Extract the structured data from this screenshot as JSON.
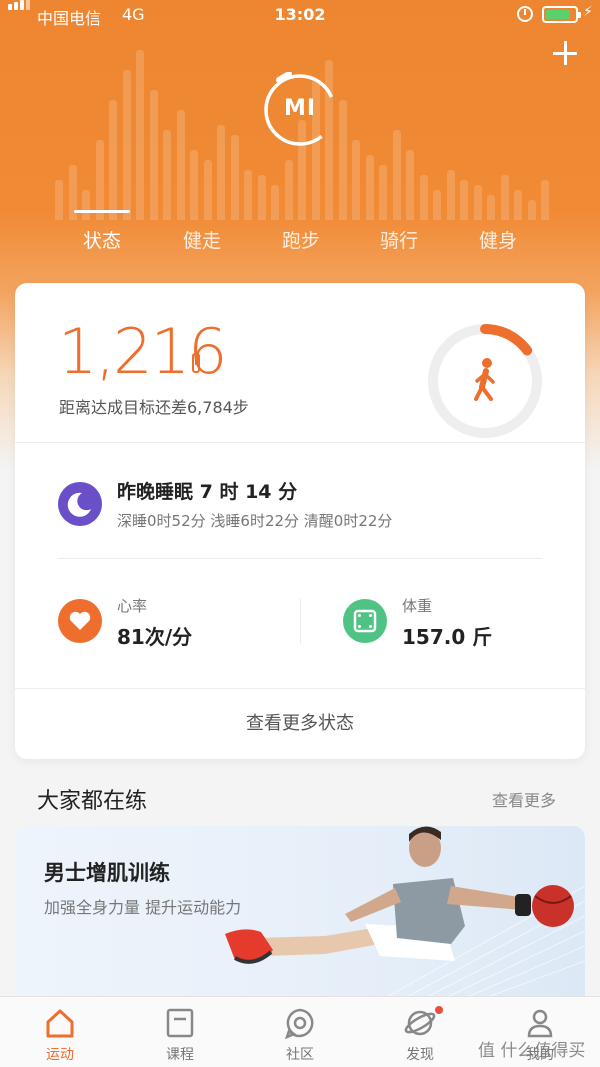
{
  "status_bar": {
    "carrier": "中国电信",
    "network": "4G",
    "time": "13:02",
    "battery_level": 0.85,
    "battery_color": "#5cd06e"
  },
  "header": {
    "logo_text": "MI",
    "add_icon": "plus-icon"
  },
  "tabs": [
    {
      "label": "状态",
      "active": true
    },
    {
      "label": "健走",
      "active": false
    },
    {
      "label": "跑步",
      "active": false
    },
    {
      "label": "骑行",
      "active": false
    },
    {
      "label": "健身",
      "active": false
    }
  ],
  "summary": {
    "steps": "1,216",
    "goal_text": "距离达成目标还差6,784步",
    "goal_progress": 0.15,
    "accent": "#ee6e2d"
  },
  "sleep": {
    "title": "昨晚睡眠 7 时 14 分",
    "detail": "深睡0时52分 浅睡6时22分 清醒0时22分"
  },
  "heart_rate": {
    "label": "心率",
    "value": "81次/分"
  },
  "weight": {
    "label": "体重",
    "value": "157.0 斤"
  },
  "more_status_label": "查看更多状态",
  "section": {
    "title": "大家都在练",
    "more": "查看更多"
  },
  "promo": {
    "title": "男士增肌训练",
    "subtitle": "加强全身力量 提升运动能力"
  },
  "nav": [
    {
      "label": "运动",
      "icon": "home-icon",
      "active": true
    },
    {
      "label": "课程",
      "icon": "course-icon",
      "active": false
    },
    {
      "label": "社区",
      "icon": "community-icon",
      "active": false
    },
    {
      "label": "发现",
      "icon": "discover-icon",
      "active": false,
      "badge": true
    },
    {
      "label": "我的",
      "icon": "profile-icon",
      "active": false
    }
  ],
  "watermark": "值 什么值得买"
}
